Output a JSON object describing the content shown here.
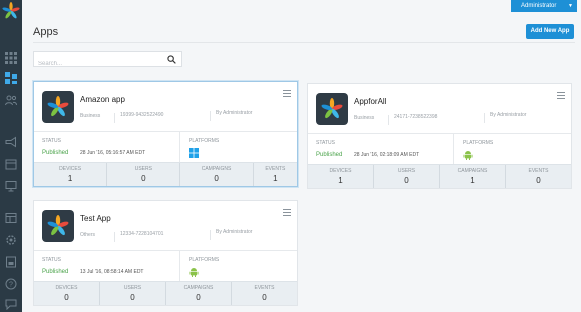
{
  "header": {
    "admin_label": "Administrator"
  },
  "page": {
    "title": "Apps",
    "add_button": "Add New App"
  },
  "search": {
    "placeholder": "Search..."
  },
  "sidebar": {
    "icons": [
      "grid-icon",
      "apps-icon",
      "users-icon",
      "megaphone-icon",
      "calendar-icon",
      "monitor-icon",
      "table-icon",
      "settings-icon",
      "report-icon",
      "help-icon",
      "chat-icon"
    ]
  },
  "labels": {
    "status": "STATUS",
    "platforms": "PLATFORMS",
    "devices": "DEVICES",
    "users": "USERS",
    "campaigns": "CAMPAIGNS",
    "events": "EVENTS"
  },
  "apps": [
    {
      "name": "Amazon app",
      "category": "Business",
      "app_id": "19399-9432522490",
      "owner": "By Administrator",
      "status": "Published",
      "date": "28 Jun '16, 05:16:57 AM EDT",
      "platform": "windows-icon",
      "devices": "1",
      "users": "0",
      "campaigns": "0",
      "events": "1"
    },
    {
      "name": "AppforAll",
      "category": "Business",
      "app_id": "24171-7238522398",
      "owner": "By Administrator",
      "status": "Published",
      "date": "28 Jun '16, 02:18:09 AM EDT",
      "platform": "android-icon",
      "devices": "1",
      "users": "0",
      "campaigns": "1",
      "events": "0"
    },
    {
      "name": "Test App",
      "category": "Others",
      "app_id": "12334-7228104701",
      "owner": "By Administrator",
      "status": "Published",
      "date": "13 Jul '16, 08:58:14 AM EDT",
      "platform": "android-icon",
      "devices": "0",
      "users": "0",
      "campaigns": "0",
      "events": "0"
    }
  ],
  "colors": {
    "accent": "#1e90d6",
    "sidebar": "#2b3a45",
    "published": "#4aa34a",
    "android": "#8bc34a",
    "windows": "#1fa1e8"
  }
}
